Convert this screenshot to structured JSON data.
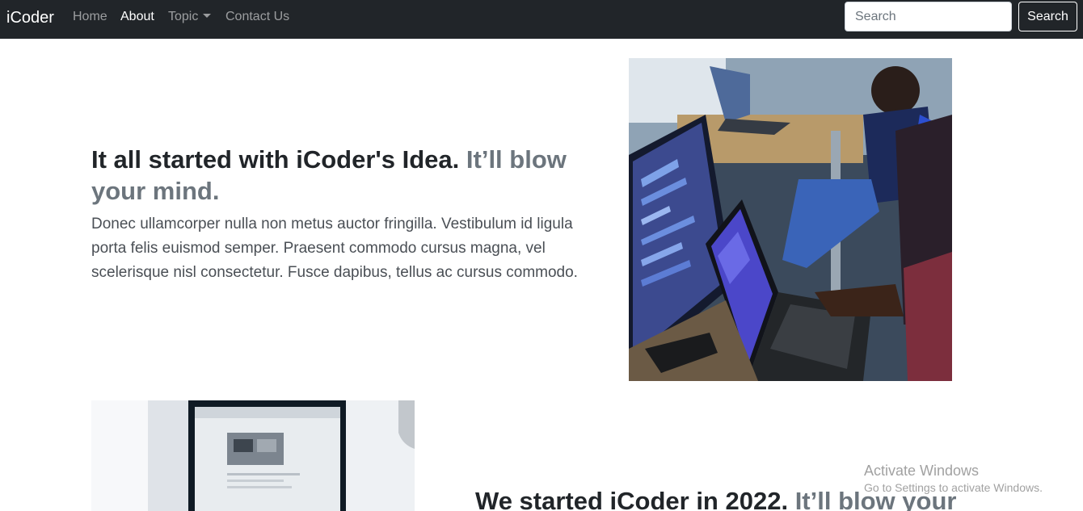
{
  "navbar": {
    "brand": "iCoder",
    "links": [
      {
        "label": "Home",
        "active": false
      },
      {
        "label": "About",
        "active": true
      },
      {
        "label": "Topic",
        "active": false,
        "dropdown": true
      },
      {
        "label": "Contact Us",
        "active": false
      }
    ],
    "search": {
      "placeholder": "Search",
      "button_label": "Search"
    }
  },
  "featurette1": {
    "heading": "It all started with iCoder's Idea.",
    "heading_muted": "It’ll blow your mind.",
    "lead": "Donec ullamcorper nulla non metus auctor fringilla. Vestibulum id ligula porta felis euismod semper. Praesent commodo cursus magna, vel scelerisque nisl consectetur. Fusce dapibus, tellus ac cursus commodo."
  },
  "featurette2": {
    "heading": "We started iCoder in 2022.",
    "heading_muted": "It’ll blow your"
  },
  "watermark": {
    "title": "Activate Windows",
    "subtitle": "Go to Settings to activate Windows."
  },
  "colors": {
    "navbar_bg": "#212529",
    "muted_text": "#6c757d"
  }
}
